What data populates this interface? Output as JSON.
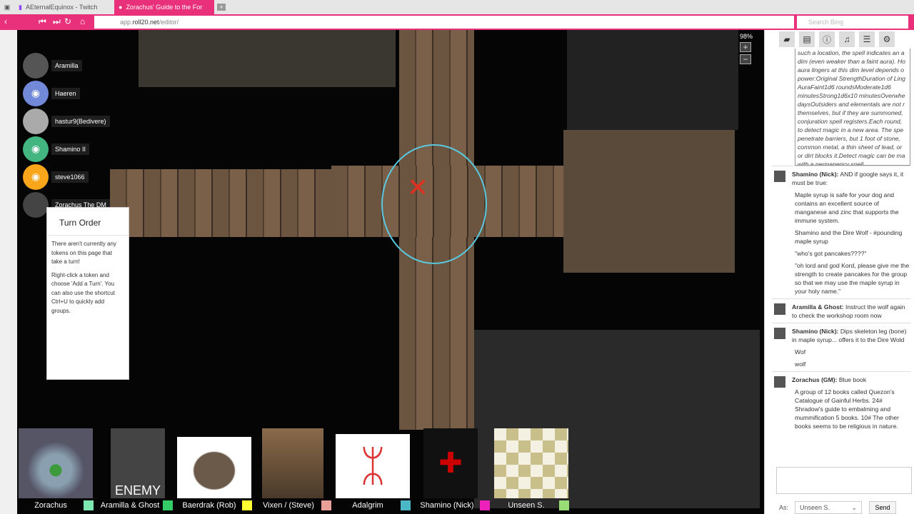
{
  "browser": {
    "tabs": [
      {
        "label": "AEternalEquinox - Twitch",
        "active": false
      },
      {
        "label": "Zorachus' Guide to the For",
        "active": true
      }
    ],
    "url_host": "app.",
    "url_domain": "roll20.net",
    "url_path": "/editor/",
    "search_placeholder": "Search Bing",
    "accent": "#e8317a"
  },
  "players": [
    {
      "name": "Aramilla",
      "color": "#666"
    },
    {
      "name": "Haeren",
      "color": "#7289da"
    },
    {
      "name": "hastur9(Bedivere)",
      "color": "#999"
    },
    {
      "name": "Shamino II",
      "color": "#43b581"
    },
    {
      "name": "steve1066",
      "color": "#faa61a"
    },
    {
      "name": "Zorachus The DM",
      "color": "#444"
    }
  ],
  "turn_order": {
    "title": "Turn Order",
    "text1": "There aren't currently any tokens on this page that take a turn!",
    "text2": "Right-click a token and choose 'Add a Turn'. You can also use the shortcut Ctrl+U to quickly add groups."
  },
  "zoom": {
    "level": "98%",
    "plus": "+",
    "minus": "−"
  },
  "portraits": [
    {
      "name": "Zorachus",
      "color": "#7de8b0",
      "bg": "#6a7a8a"
    },
    {
      "name": "Aramilla & Ghost",
      "color": "#33cc66",
      "bg": "#555"
    },
    {
      "name": "Baerdrak (Rob)",
      "color": "#ffff33",
      "bg": "#fff"
    },
    {
      "name": "Vixen / (Steve)",
      "color": "#e8a098",
      "bg": "#6b5040"
    },
    {
      "name": "Adalgrim",
      "color": "#4bb8c8",
      "bg": "#fff"
    },
    {
      "name": "Shamino (Nick)",
      "color": "#ee22bb",
      "bg": "#111"
    },
    {
      "name": "Unseen S.",
      "color": "#99dd77",
      "bg": "#f4f1e2"
    }
  ],
  "portrait_caption": "ENEMY",
  "chat": {
    "spell_lines": [
      "such a location, the spell indicates an a",
      "dim (even weaker than a faint aura). Ho",
      "aura lingers at this dim level depends o",
      "power:Original StrengthDuration of Ling",
      "AuraFaint1d6 roundsModerate1d6",
      "minutesStrong1d6x10 minutesOverwhe",
      "daysOutsiders and elementals are not r",
      "themselves, but if they are summoned,",
      "conjuration spell registers.Each round,",
      "to detect magic in a new area. The spe",
      "penetrate barriers, but 1 foot of stone,",
      "common metal, a thin sheet of lead, or",
      "or dirt blocks it.Detect magic can be ma",
      "with a permanency spell."
    ],
    "messages": [
      {
        "who": "Shamino (Nick):",
        "text": "AND if google says it, it must be true:",
        "lines": [
          "Maple syrup is safe for your dog and contains an excellent source of manganese and zinc that supports the immune system.",
          "Shamino and the Dire Wolf - #pounding maple syrup",
          "\"who's got pancakes????\"",
          "\"oh lord and god Kord, please give me the strength to create pancakes for the group so that we may use the maple syrup in your holy name.\""
        ]
      },
      {
        "who": "Aramilla & Ghost:",
        "text": "Instruct the wolf again to check the workshop room now",
        "lines": []
      },
      {
        "who": "Shamino (Nick):",
        "text": "Dips skeleton leg (bone) in maple syrup... offers it to the Dire Wold",
        "lines": [
          "Wof",
          "wolf"
        ]
      },
      {
        "who": "Zorachus (GM):",
        "text": "Blue book",
        "lines": [
          "A group of 12 books called Quezon's Catalogue of Gainful Herbs. 24# Shradow's guide to embalming and mummification 5 books. 10# The other books seems to be religious in nature."
        ]
      }
    ],
    "as_label": "As:",
    "as_value": "Unseen S.",
    "send_label": "Send"
  }
}
